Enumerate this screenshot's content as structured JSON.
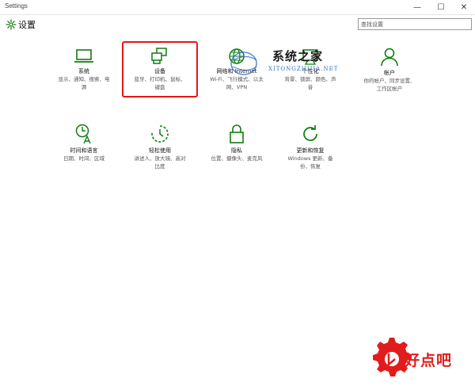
{
  "window": {
    "title": "Settings",
    "controls": {
      "minimize": "—",
      "maximize": "☐",
      "close": "✕"
    }
  },
  "header": {
    "title": "设置",
    "search_placeholder": "查找设置"
  },
  "tiles": [
    {
      "name": "系统",
      "desc": [
        "显示、通知、搜索、电",
        "源"
      ],
      "icon": "laptop-icon"
    },
    {
      "name": "设备",
      "desc": [
        "蓝牙、打印机、鼠标、",
        "键盘"
      ],
      "icon": "printer-icon"
    },
    {
      "name": "网络和 Internet",
      "desc": [
        "Wi-Fi、飞行模式、以太",
        "网、VPN"
      ],
      "icon": "globe-icon"
    },
    {
      "name": "个性化",
      "desc": [
        "背景、锁屏、颜色、声",
        "音"
      ],
      "icon": "paint-brush-icon"
    },
    {
      "name": "帐户",
      "desc": [
        "你的帐户、同步设置、",
        "工作区帐户"
      ],
      "icon": "person-icon"
    },
    {
      "name": "时间和语言",
      "desc": [
        "日期、时间、区域"
      ],
      "icon": "clock-language-icon"
    },
    {
      "name": "轻松使用",
      "desc": [
        "讲述人、放大镜、高对",
        "比度"
      ],
      "icon": "timer-icon"
    },
    {
      "name": "隐私",
      "desc": [
        "位置、摄像头、麦克风"
      ],
      "icon": "lock-icon"
    },
    {
      "name": "更新和恢复",
      "desc": [
        "Windows 更新、备",
        "份、恢复"
      ],
      "icon": "refresh-icon"
    }
  ],
  "watermark": {
    "text": "系统之家",
    "sub": "XITONGZHIJIA.NET"
  },
  "brand": {
    "text": "好点吧"
  },
  "colors": {
    "accent": "#107c10",
    "highlight": "#e01818",
    "brand": "#e21c1c"
  }
}
